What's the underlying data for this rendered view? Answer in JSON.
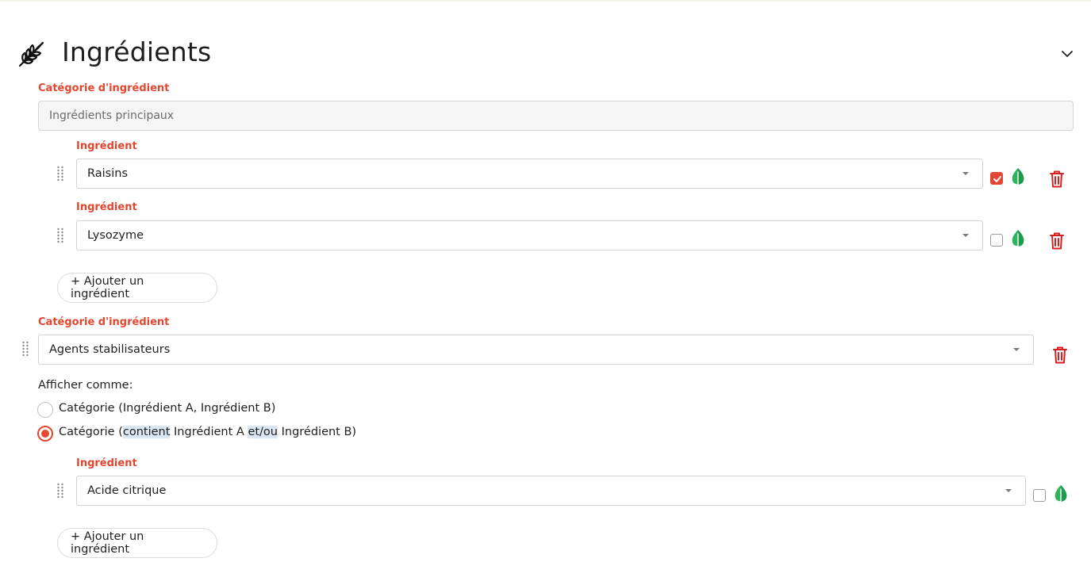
{
  "section": {
    "title": "Ingrédients",
    "icon": "wheat-icon",
    "collapse_icon": "chevron-down-icon"
  },
  "colors": {
    "accent": "#e2472f",
    "leaf": "#2fb35d",
    "trash": "#d71f1f"
  },
  "categories": [
    {
      "label": "Catégorie d'ingrédient",
      "value": "Ingrédients principaux",
      "ingredients": [
        {
          "label": "Ingrédient",
          "value": "Raisins",
          "checked": true
        },
        {
          "label": "Ingrédient",
          "value": "Lysozyme",
          "checked": false
        }
      ],
      "add_label": "+ Ajouter un ingrédient"
    },
    {
      "label": "Catégorie d'ingrédient",
      "value": "Agents stabilisateurs",
      "display_as": {
        "label": "Afficher comme:",
        "options": [
          {
            "label": "Catégorie (Ingrédient A, Ingrédient B)",
            "selected": false
          },
          {
            "prefix": "Catégorie (",
            "hl1": "contient",
            "mid": " Ingrédient A ",
            "hl2": "et/ou",
            "suffix": " Ingrédient B)",
            "selected": true
          }
        ]
      },
      "ingredients": [
        {
          "label": "Ingrédient",
          "value": "Acide citrique",
          "checked": false
        }
      ],
      "add_label": "+ Ajouter un ingrédient"
    }
  ]
}
